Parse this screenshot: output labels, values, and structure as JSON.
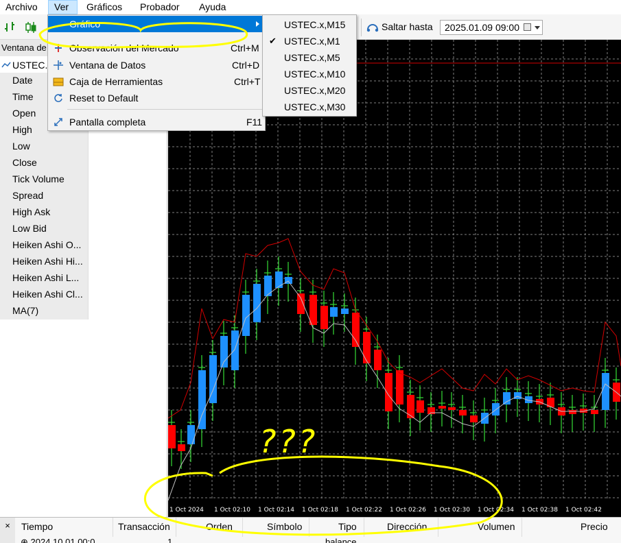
{
  "menubar": {
    "items": [
      {
        "label": "Archivo"
      },
      {
        "label": "Ver"
      },
      {
        "label": "Gráficos"
      },
      {
        "label": "Probador"
      },
      {
        "label": "Ayuda"
      }
    ]
  },
  "toolbar": {
    "jump_label": "Saltar hasta",
    "jump_date": "2025.01.09 09:00"
  },
  "data_window": {
    "title": "Ventana de",
    "symbol": "USTEC.x",
    "rows": [
      {
        "label": "Date"
      },
      {
        "label": "Time"
      },
      {
        "label": "Open"
      },
      {
        "label": "High"
      },
      {
        "label": "Low"
      },
      {
        "label": "Close"
      },
      {
        "label": "Tick Volume"
      },
      {
        "label": "Spread"
      },
      {
        "label": "High Ask"
      },
      {
        "label": "Low Bid"
      },
      {
        "label": "Heiken Ashi O..."
      },
      {
        "label": "Heiken Ashi Hi..."
      },
      {
        "label": "Heiken Ashi L..."
      },
      {
        "label": "Heiken Ashi Cl..."
      },
      {
        "label": "MA(7)"
      }
    ]
  },
  "ver_menu": {
    "items": [
      {
        "label": "Gráfico",
        "shortcut": ""
      },
      {
        "label": "Observación del Mercado",
        "shortcut": "Ctrl+M"
      },
      {
        "label": "Ventana de Datos",
        "shortcut": "Ctrl+D"
      },
      {
        "label": "Caja de Herramientas",
        "shortcut": "Ctrl+T"
      },
      {
        "label": "Reset to Default",
        "shortcut": ""
      },
      {
        "label": "Pantalla completa",
        "shortcut": "F11"
      }
    ]
  },
  "chart_submenu": {
    "items": [
      {
        "label": "USTEC.x,M15",
        "checked": false
      },
      {
        "label": "USTEC.x,M1",
        "checked": true
      },
      {
        "label": "USTEC.x,M5",
        "checked": false
      },
      {
        "label": "USTEC.x,M10",
        "checked": false
      },
      {
        "label": "USTEC.x,M20",
        "checked": false
      },
      {
        "label": "USTEC.x,M30",
        "checked": false
      }
    ],
    "check_mark": "✔"
  },
  "chart": {
    "x_labels": [
      "1 Oct 2024",
      "1 Oct 02:10",
      "1 Oct 02:14",
      "1 Oct 02:18",
      "1 Oct 02:22",
      "1 Oct 02:26",
      "1 Oct 02:30",
      "1 Oct 02:34",
      "1 Oct 02:38",
      "1 Oct 02:42"
    ],
    "colors": {
      "bull": "#1e90ff",
      "bear": "#ff0000",
      "wick": "#32cd32",
      "ma": "#c0c0c0",
      "envelope": "#d40000",
      "grid": "#808080"
    }
  },
  "bottom_panel": {
    "close": "×",
    "columns": [
      "Tiempo",
      "Transacción",
      "Orden",
      "Símbolo",
      "Tipo",
      "Dirección",
      "Volumen",
      "Precio"
    ],
    "first_row": {
      "time": "2024.10.01 00:0",
      "transaction": "1",
      "type": "balance"
    }
  },
  "annotation": {
    "text": "???",
    "color": "#ffff00"
  }
}
